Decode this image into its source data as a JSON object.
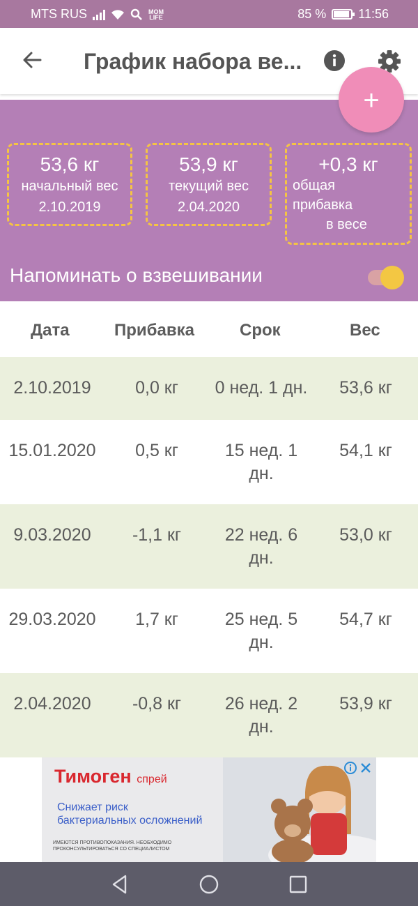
{
  "status_bar": {
    "carrier": "MTS RUS",
    "battery": "85 %",
    "time": "11:56",
    "icons": [
      "signal-icon",
      "wifi-icon",
      "search-icon",
      "momlife-icon",
      "battery-icon"
    ]
  },
  "app_bar": {
    "title": "График набора ве...",
    "icons": [
      "back-arrow-icon",
      "info-icon",
      "gear-icon"
    ]
  },
  "fab": {
    "label": "+"
  },
  "summary": {
    "start": {
      "value": "53,6 кг",
      "label": "начальный вес",
      "date": "2.10.2019"
    },
    "current": {
      "value": "53,9 кг",
      "label": "текущий вес",
      "date": "2.04.2020"
    },
    "gain": {
      "value": "+0,3 кг",
      "line1": "общая",
      "line2": "прибавка",
      "line3": "в весе"
    }
  },
  "reminder": {
    "label": "Напоминать о взвешивании",
    "enabled": true
  },
  "table": {
    "headers": [
      "Дата",
      "Прибавка",
      "Срок",
      "Вес"
    ],
    "rows": [
      {
        "date": "2.10.2019",
        "gain": "0,0 кг",
        "term": "0 нед. 1 дн.",
        "weight": "53,6 кг"
      },
      {
        "date": "15.01.2020",
        "gain": "0,5 кг",
        "term": "15 нед. 1 дн.",
        "weight": "54,1 кг"
      },
      {
        "date": "9.03.2020",
        "gain": "-1,1 кг",
        "term": "22 нед. 6 дн.",
        "weight": "53,0 кг"
      },
      {
        "date": "29.03.2020",
        "gain": "1,7 кг",
        "term": "25 нед. 5 дн.",
        "weight": "54,7 кг"
      },
      {
        "date": "2.04.2020",
        "gain": "-0,8 кг",
        "term": "26 нед. 2 дн.",
        "weight": "53,9 кг"
      }
    ]
  },
  "ad": {
    "brand": "Тимоген",
    "brand_suffix": "спрей",
    "slogan_line1": "Снижает риск",
    "slogan_line2": "бактериальных осложнений",
    "disclaimer": "ИМЕЮТСЯ ПРОТИВОПОКАЗАНИЯ. НЕОБХОДИМО ПРОКОНСУЛЬТИРОВАТЬСЯ СО СПЕЦИАЛИСТОМ"
  },
  "colors": {
    "status_bar": "#a8789f",
    "header": "#b47fb6",
    "fab": "#f08db8",
    "card_border": "#f5c443",
    "row_shaded": "#ebf0dd",
    "nav_bar": "#5d5c69"
  }
}
